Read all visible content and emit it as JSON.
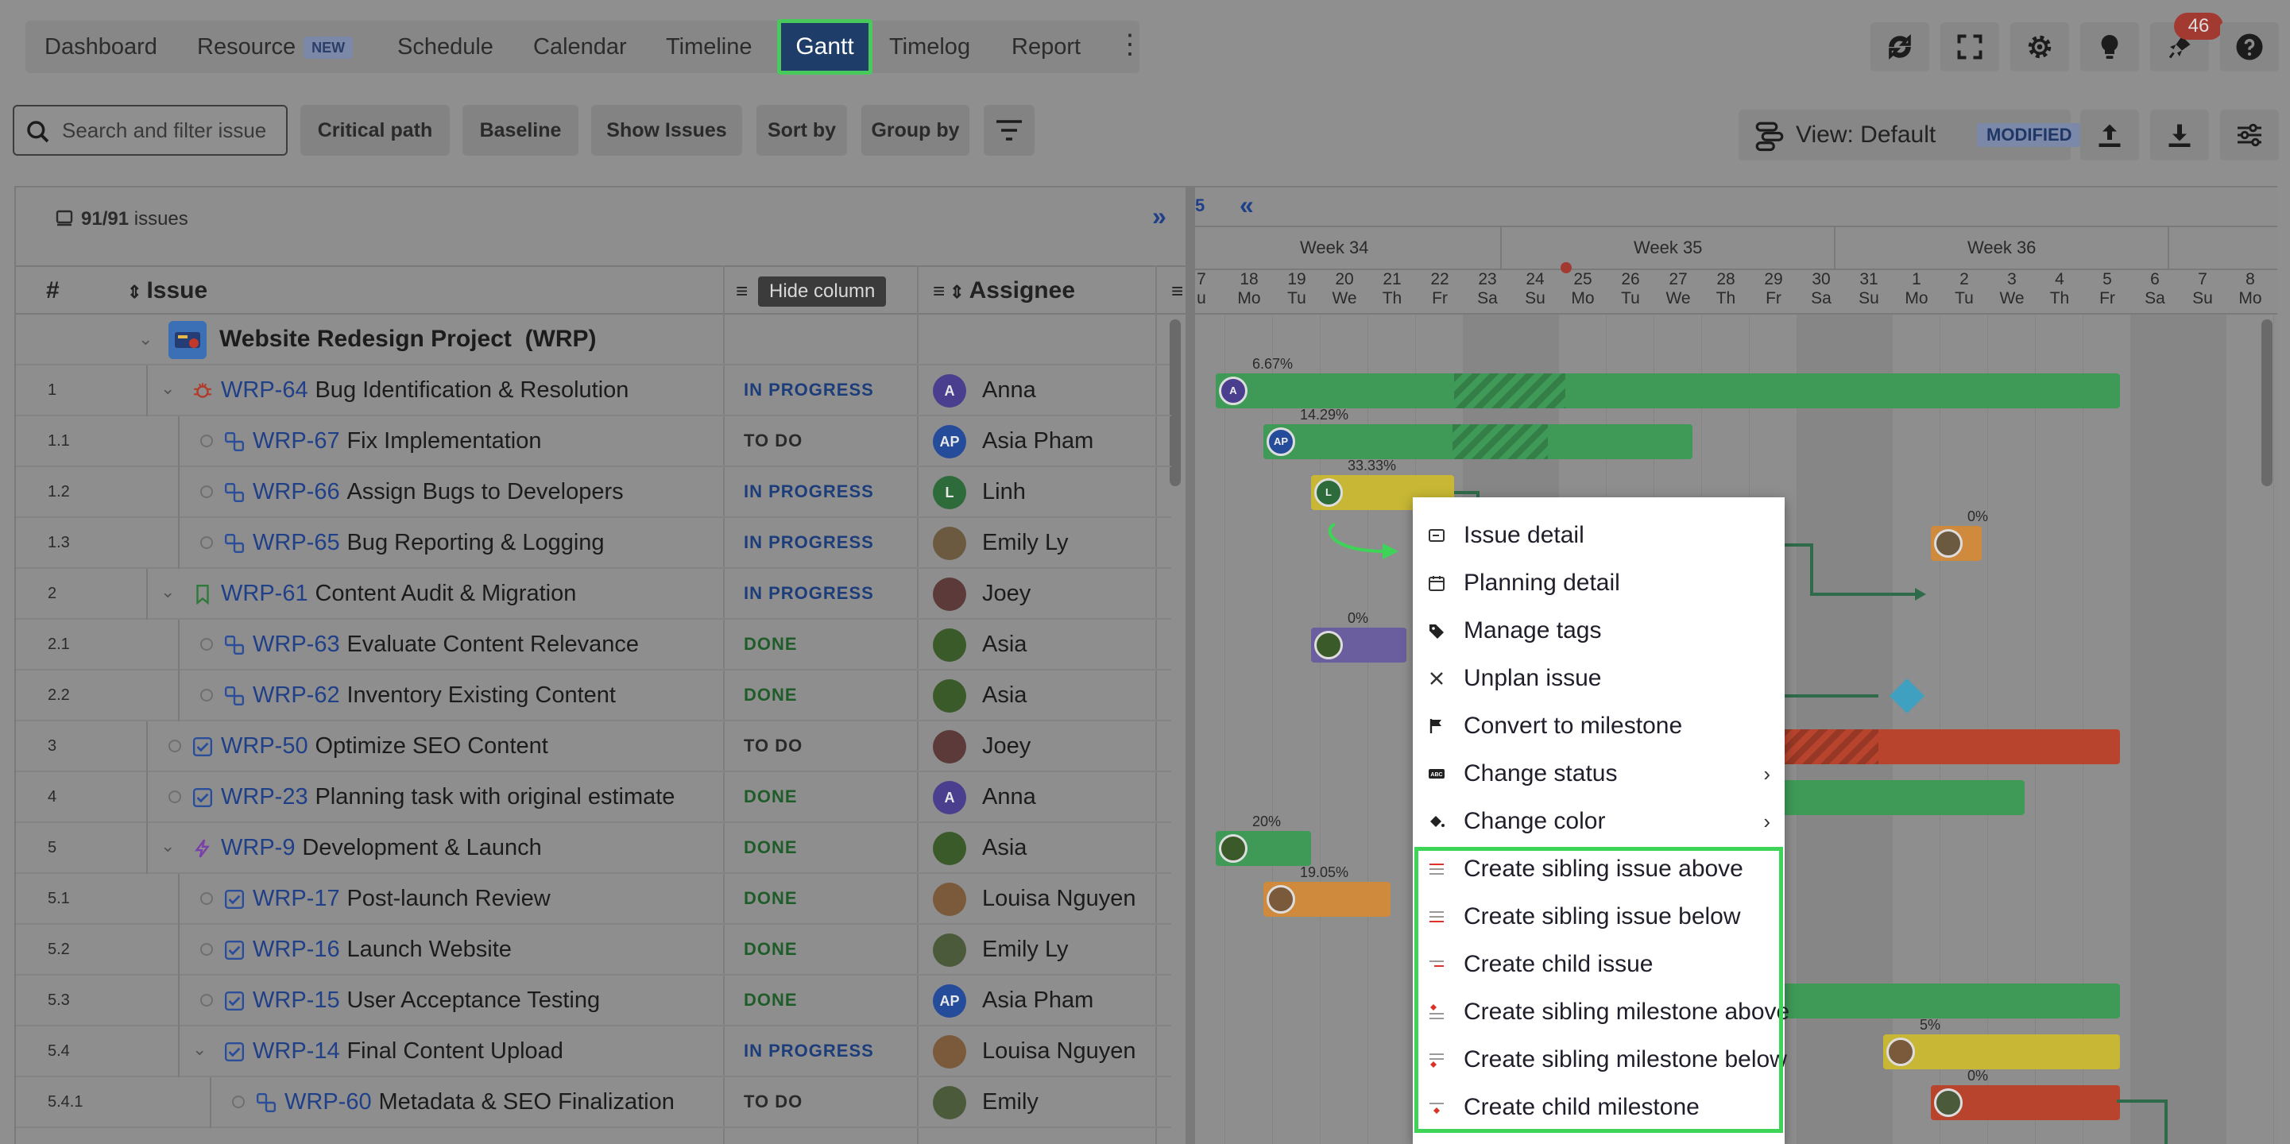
{
  "nav": {
    "tabs": [
      "Dashboard",
      "Resource",
      "Schedule",
      "Calendar",
      "Timeline",
      "Gantt",
      "Timelog",
      "Report"
    ],
    "resource_badge": "NEW",
    "active_tab": "Gantt",
    "notification_count": "46"
  },
  "toolbar": {
    "search_placeholder": "Search and filter issue",
    "critical_path": "Critical path",
    "baseline": "Baseline",
    "show_issues": "Show Issues",
    "sort_by": "Sort by",
    "group_by": "Group by",
    "view_label": "View: Default",
    "view_badge": "MODIFIED"
  },
  "grid": {
    "count": "91/91",
    "count_suffix": "issues",
    "headers": {
      "num": "#",
      "issue": "Issue",
      "assignee": "Assignee"
    },
    "tooltip": "Hide column",
    "project": {
      "name": "Website Redesign Project",
      "key": "(WRP)"
    },
    "rows": [
      {
        "num": "1",
        "key": "WRP-64",
        "title": "Bug Identification & Resolution",
        "status": "IN PROGRESS",
        "assignee": "Anna",
        "initials": "A"
      },
      {
        "num": "1.1",
        "key": "WRP-67",
        "title": "Fix Implementation",
        "status": "TO DO",
        "assignee": "Asia Pham",
        "initials": "AP"
      },
      {
        "num": "1.2",
        "key": "WRP-66",
        "title": "Assign Bugs to Developers",
        "status": "IN PROGRESS",
        "assignee": "Linh",
        "initials": "L"
      },
      {
        "num": "1.3",
        "key": "WRP-65",
        "title": "Bug Reporting & Logging",
        "status": "IN PROGRESS",
        "assignee": "Emily Ly",
        "initials": ""
      },
      {
        "num": "2",
        "key": "WRP-61",
        "title": "Content Audit & Migration",
        "status": "IN PROGRESS",
        "assignee": "Joey",
        "initials": ""
      },
      {
        "num": "2.1",
        "key": "WRP-63",
        "title": "Evaluate Content Relevance",
        "status": "DONE",
        "assignee": "Asia",
        "initials": ""
      },
      {
        "num": "2.2",
        "key": "WRP-62",
        "title": "Inventory Existing Content",
        "status": "DONE",
        "assignee": "Asia",
        "initials": ""
      },
      {
        "num": "3",
        "key": "WRP-50",
        "title": "Optimize SEO Content",
        "status": "TO DO",
        "assignee": "Joey",
        "initials": ""
      },
      {
        "num": "4",
        "key": "WRP-23",
        "title": "Planning task with original estimate",
        "status": "DONE",
        "assignee": "Anna",
        "initials": "A"
      },
      {
        "num": "5",
        "key": "WRP-9",
        "title": "Development & Launch",
        "status": "DONE",
        "assignee": "Asia",
        "initials": ""
      },
      {
        "num": "5.1",
        "key": "WRP-17",
        "title": "Post-launch Review",
        "status": "DONE",
        "assignee": "Louisa Nguyen",
        "initials": ""
      },
      {
        "num": "5.2",
        "key": "WRP-16",
        "title": "Launch Website",
        "status": "DONE",
        "assignee": "Emily Ly",
        "initials": ""
      },
      {
        "num": "5.3",
        "key": "WRP-15",
        "title": "User Acceptance Testing",
        "status": "DONE",
        "assignee": "Asia Pham",
        "initials": "AP"
      },
      {
        "num": "5.4",
        "key": "WRP-14",
        "title": "Final Content Upload",
        "status": "IN PROGRESS",
        "assignee": "Louisa Nguyen",
        "initials": ""
      },
      {
        "num": "5.4.1",
        "key": "WRP-60",
        "title": "Metadata & SEO Finalization",
        "status": "TO DO",
        "assignee": "Emily",
        "initials": ""
      }
    ]
  },
  "gantt": {
    "partial_week_label": "5",
    "weeks": [
      "Week 34",
      "Week 35",
      "Week 36"
    ],
    "days": [
      {
        "d": "7",
        "w": "u"
      },
      {
        "d": "18",
        "w": "Mo"
      },
      {
        "d": "19",
        "w": "Tu"
      },
      {
        "d": "20",
        "w": "We"
      },
      {
        "d": "21",
        "w": "Th"
      },
      {
        "d": "22",
        "w": "Fr"
      },
      {
        "d": "23",
        "w": "Sa"
      },
      {
        "d": "24",
        "w": "Su"
      },
      {
        "d": "25",
        "w": "Mo"
      },
      {
        "d": "26",
        "w": "Tu"
      },
      {
        "d": "27",
        "w": "We"
      },
      {
        "d": "28",
        "w": "Th"
      },
      {
        "d": "29",
        "w": "Fr"
      },
      {
        "d": "30",
        "w": "Sa"
      },
      {
        "d": "31",
        "w": "Su"
      },
      {
        "d": "1",
        "w": "Mo"
      },
      {
        "d": "2",
        "w": "Tu"
      },
      {
        "d": "3",
        "w": "We"
      },
      {
        "d": "4",
        "w": "Th"
      },
      {
        "d": "5",
        "w": "Fr"
      },
      {
        "d": "6",
        "w": "Sa"
      },
      {
        "d": "7",
        "w": "Su"
      },
      {
        "d": "8",
        "w": "Mo"
      }
    ],
    "progress_labels": [
      "6.67%",
      "14.29%",
      "33.33%",
      "0%",
      "0%",
      "20%",
      "19.05%",
      "5%",
      "0%"
    ]
  },
  "menu": {
    "items": [
      {
        "label": "Issue detail",
        "icon": "card-icon",
        "arrow": false
      },
      {
        "label": "Planning detail",
        "icon": "calendar-icon",
        "arrow": false
      },
      {
        "label": "Manage tags",
        "icon": "tag-icon",
        "arrow": false
      },
      {
        "label": "Unplan issue",
        "icon": "x-icon",
        "arrow": false
      },
      {
        "label": "Convert to milestone",
        "icon": "flag-icon",
        "arrow": false
      },
      {
        "label": "Change status",
        "icon": "abc-icon",
        "arrow": true
      },
      {
        "label": "Change color",
        "icon": "paint-bucket-icon",
        "arrow": true
      },
      {
        "label": "Create sibling issue above",
        "icon": "sibling-above-icon",
        "arrow": false
      },
      {
        "label": "Create sibling issue below",
        "icon": "sibling-below-icon",
        "arrow": false
      },
      {
        "label": "Create child issue",
        "icon": "child-issue-icon",
        "arrow": false
      },
      {
        "label": "Create sibling milestone above",
        "icon": "milestone-above-icon",
        "arrow": false
      },
      {
        "label": "Create sibling milestone below",
        "icon": "milestone-below-icon",
        "arrow": false
      },
      {
        "label": "Create child milestone",
        "icon": "child-milestone-icon",
        "arrow": false
      }
    ],
    "arrow_glyph": "›"
  },
  "colors": {
    "accent_highlight": "#3ed457",
    "green_bar": "#3f9a58",
    "yellow_bar": "#c7b734",
    "orange_bar": "#cf8a3d",
    "red_bar": "#b8442e",
    "purple_bar": "#6b5e9e",
    "link_blue": "#1f3f88"
  }
}
